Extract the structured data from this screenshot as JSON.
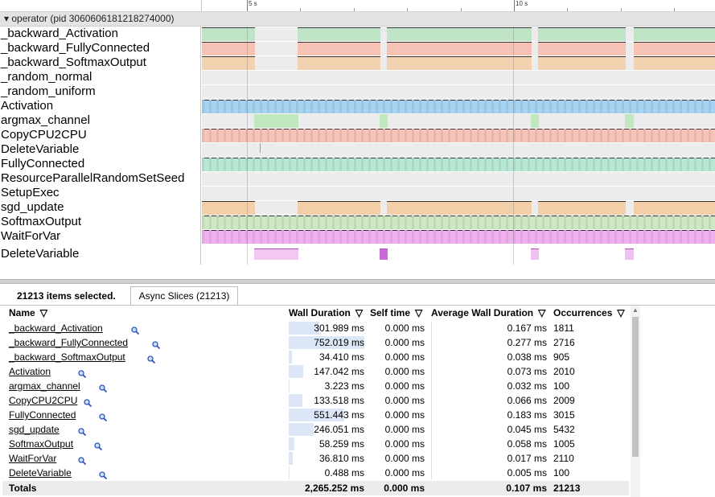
{
  "ruler": {
    "labels": [
      {
        "text": "5 s",
        "t": 5
      },
      {
        "text": "10 s",
        "t": 10
      }
    ]
  },
  "process": {
    "label": "▾ operator (pid 3060606181218274000)"
  },
  "tracks": [
    {
      "name": "_backward_Activation",
      "color": "#bfe4c6",
      "kind": "busy"
    },
    {
      "name": "_backward_FullyConnected",
      "color": "#f7c2b6",
      "kind": "busy"
    },
    {
      "name": "_backward_SoftmaxOutput",
      "color": "#f3d2b0",
      "kind": "busy"
    },
    {
      "name": "_random_normal",
      "color": "#ececec",
      "kind": "empty"
    },
    {
      "name": "_random_uniform",
      "color": "#ececec",
      "kind": "empty"
    },
    {
      "name": "Activation",
      "color": "#a7d3f2",
      "kind": "full"
    },
    {
      "name": "argmax_channel",
      "color": "#bfe8bf",
      "kind": "sparse"
    },
    {
      "name": "CopyCPU2CPU",
      "color": "#f6c4b8",
      "kind": "full"
    },
    {
      "name": "DeleteVariable",
      "color": "#ececec",
      "kind": "tiny"
    },
    {
      "name": "FullyConnected",
      "color": "#b8e8d4",
      "kind": "full"
    },
    {
      "name": "ResourceParallelRandomSetSeed",
      "color": "#ececec",
      "kind": "empty"
    },
    {
      "name": "SetupExec",
      "color": "#ececec",
      "kind": "empty"
    },
    {
      "name": "sgd_update",
      "color": "#f2cfa8",
      "kind": "busy"
    },
    {
      "name": "SoftmaxOutput",
      "color": "#cfe8c4",
      "kind": "full"
    },
    {
      "name": "WaitForVar",
      "color": "#f0b0f0",
      "kind": "full"
    },
    {
      "name": "DeleteVariable",
      "color": "#f2c7f2",
      "kind": "async"
    }
  ],
  "panel": {
    "selection": "21213 items selected.",
    "tab": "Async Slices (21213)",
    "columns": {
      "name": "Name",
      "wall": "Wall Duration",
      "self": "Self time",
      "avg": "Average Wall Duration",
      "occ": "Occurrences",
      "sort": "▽"
    },
    "rows": [
      {
        "name": "_backward_Activation",
        "wall": "301.989 ms",
        "wall_ms": 301.989,
        "self": "0.000 ms",
        "avg": "0.167 ms",
        "occ": "1811"
      },
      {
        "name": "_backward_FullyConnected",
        "wall": "752.019 ms",
        "wall_ms": 752.019,
        "self": "0.000 ms",
        "avg": "0.277 ms",
        "occ": "2716"
      },
      {
        "name": "_backward_SoftmaxOutput",
        "wall": "34.410 ms",
        "wall_ms": 34.41,
        "self": "0.000 ms",
        "avg": "0.038 ms",
        "occ": "905"
      },
      {
        "name": "Activation",
        "wall": "147.042 ms",
        "wall_ms": 147.042,
        "self": "0.000 ms",
        "avg": "0.073 ms",
        "occ": "2010"
      },
      {
        "name": "argmax_channel",
        "wall": "3.223 ms",
        "wall_ms": 3.223,
        "self": "0.000 ms",
        "avg": "0.032 ms",
        "occ": "100"
      },
      {
        "name": "CopyCPU2CPU",
        "wall": "133.518 ms",
        "wall_ms": 133.518,
        "self": "0.000 ms",
        "avg": "0.066 ms",
        "occ": "2009"
      },
      {
        "name": "FullyConnected",
        "wall": "551.443 ms",
        "wall_ms": 551.443,
        "self": "0.000 ms",
        "avg": "0.183 ms",
        "occ": "3015"
      },
      {
        "name": "sgd_update",
        "wall": "246.051 ms",
        "wall_ms": 246.051,
        "self": "0.000 ms",
        "avg": "0.045 ms",
        "occ": "5432"
      },
      {
        "name": "SoftmaxOutput",
        "wall": "58.259 ms",
        "wall_ms": 58.259,
        "self": "0.000 ms",
        "avg": "0.058 ms",
        "occ": "1005"
      },
      {
        "name": "WaitForVar",
        "wall": "36.810 ms",
        "wall_ms": 36.81,
        "self": "0.000 ms",
        "avg": "0.017 ms",
        "occ": "2110"
      },
      {
        "name": "DeleteVariable",
        "wall": "0.488 ms",
        "wall_ms": 0.488,
        "self": "0.000 ms",
        "avg": "0.005 ms",
        "occ": "100"
      }
    ],
    "totals": {
      "label": "Totals",
      "wall": "2,265.252 ms",
      "self": "0.000 ms",
      "avg": "0.107 ms",
      "occ": "21213"
    }
  }
}
